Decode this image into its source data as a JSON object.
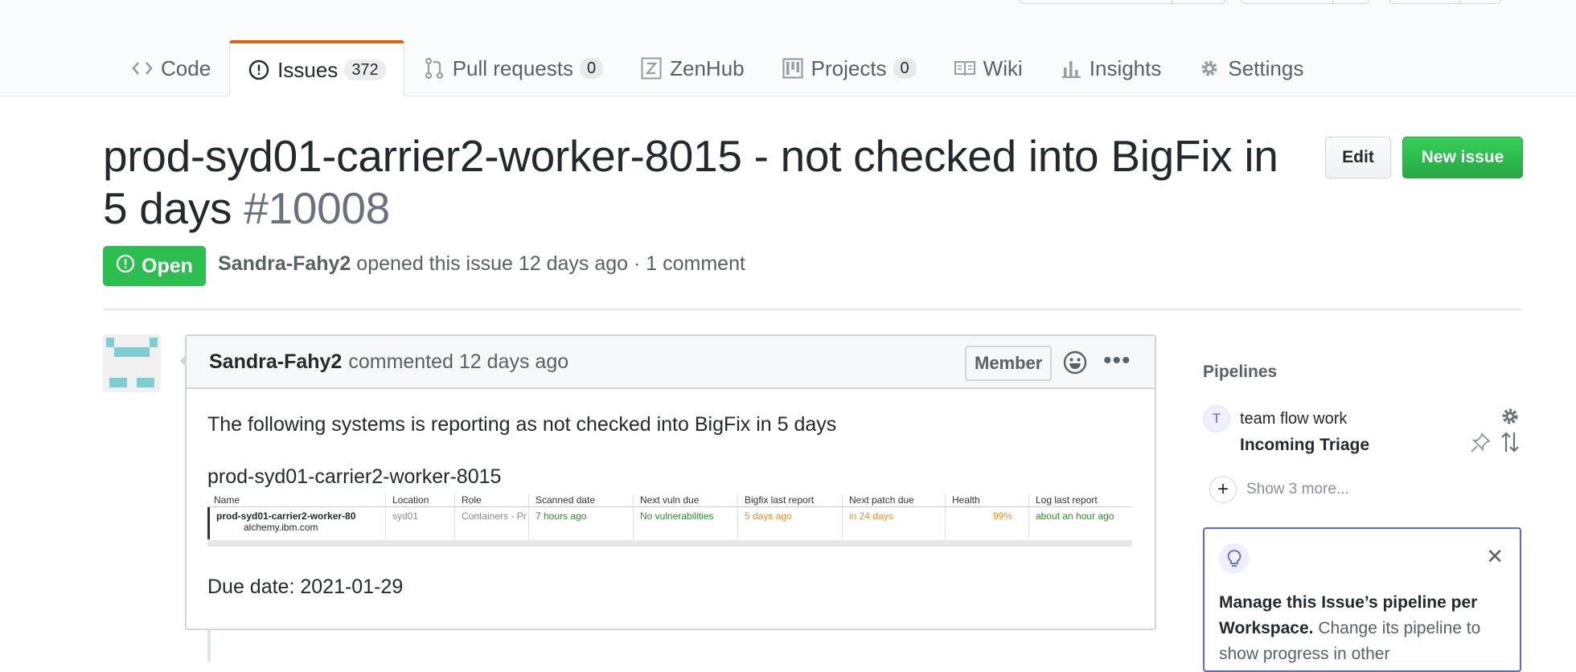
{
  "tabs": [
    {
      "label": "Code",
      "icon": "code-icon",
      "count": null
    },
    {
      "label": "Issues",
      "icon": "issue-opened-icon",
      "count": "372",
      "selected": true
    },
    {
      "label": "Pull requests",
      "icon": "git-pull-request-icon",
      "count": "0"
    },
    {
      "label": "ZenHub",
      "icon": "zenhub-icon",
      "count": null
    },
    {
      "label": "Projects",
      "icon": "project-icon",
      "count": "0"
    },
    {
      "label": "Wiki",
      "icon": "book-icon",
      "count": null
    },
    {
      "label": "Insights",
      "icon": "graph-icon",
      "count": null
    },
    {
      "label": "Settings",
      "icon": "gear-icon",
      "count": null
    }
  ],
  "issue": {
    "title": "prod-syd01-carrier2-worker-8015 - not checked into BigFix in 5 days",
    "number": "#10008",
    "state": "Open",
    "author": "Sandra-Fahy2",
    "meta_rest": "opened this issue 12 days ago · 1 comment",
    "edit_label": "Edit",
    "new_issue_label": "New issue"
  },
  "comment": {
    "author": "Sandra-Fahy2",
    "action": "commented 12 days ago",
    "badge": "Member",
    "body_line1": "The following systems is reporting as not checked into BigFix in 5 days",
    "body_line2": "prod-syd01-carrier2-worker-8015",
    "body_line3": "Due date: 2021-01-29"
  },
  "snapshot_table": {
    "headers": [
      "Name",
      "Location",
      "Role",
      "Scanned date",
      "Next vuln due",
      "Bigfix last report",
      "Next patch due",
      "Health",
      "Log last report"
    ],
    "row": {
      "name": "prod-syd01-carrier2-worker-80",
      "name_sub": "alchemy.ibm.com",
      "location": "syd01",
      "role": "Containers - Pr",
      "scanned": "7 hours ago",
      "vuln": "No vulnerabilities",
      "bigfix": "5 days ago",
      "patch": "in 24 days",
      "health": "99%",
      "log": "about an hour ago"
    }
  },
  "sidebar": {
    "title": "Pipelines",
    "avatar_letter": "T",
    "workspace": "team flow work",
    "pipeline": "Incoming Triage",
    "show_more": "Show 3 more...",
    "tip_bold": "Manage this Issue’s pipeline per Workspace.",
    "tip_text": " Change its pipeline to show progress in other"
  },
  "colors": {
    "accent_tab": "#e36209",
    "open_green": "#2cbe4e",
    "new_issue_green": "#28a745",
    "zenhub_purple": "#5a67d8"
  }
}
